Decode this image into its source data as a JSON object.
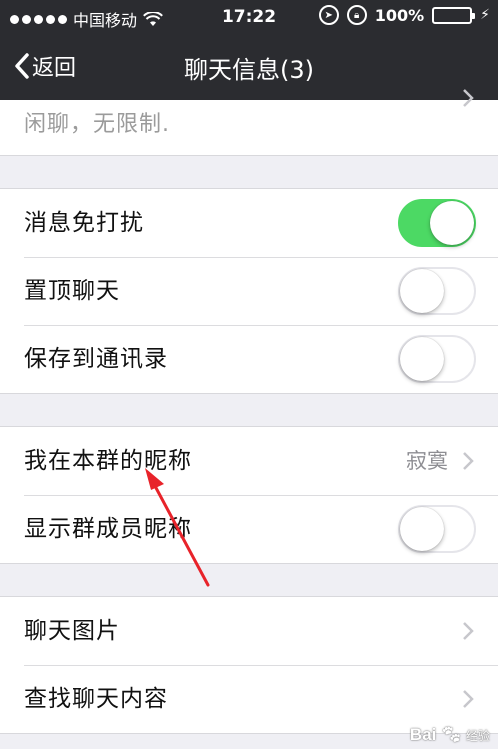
{
  "status_bar": {
    "carrier": "中国移动",
    "time": "17:22",
    "battery": "100%",
    "battery_level": 1.0
  },
  "nav": {
    "back_label": "返回",
    "title": "聊天信息(3)"
  },
  "partial_row": {
    "text": "闲聊，无限制."
  },
  "settings_group_1": [
    {
      "label": "消息免打扰",
      "on": true
    },
    {
      "label": "置顶聊天",
      "on": false
    },
    {
      "label": "保存到通讯录",
      "on": false
    }
  ],
  "settings_group_2": {
    "nickname_label": "我在本群的昵称",
    "nickname_value": "寂寞",
    "show_nick_label": "显示群成员昵称",
    "show_nick_on": false
  },
  "settings_group_3": [
    {
      "label": "聊天图片"
    },
    {
      "label": "查找聊天内容"
    }
  ],
  "watermark": {
    "brand": "Bai",
    "brand_suffix": "经验"
  },
  "colors": {
    "switch_on": "#4cd964",
    "bar_bg": "#2b2c30",
    "annotation_arrow": "#e8232a"
  }
}
